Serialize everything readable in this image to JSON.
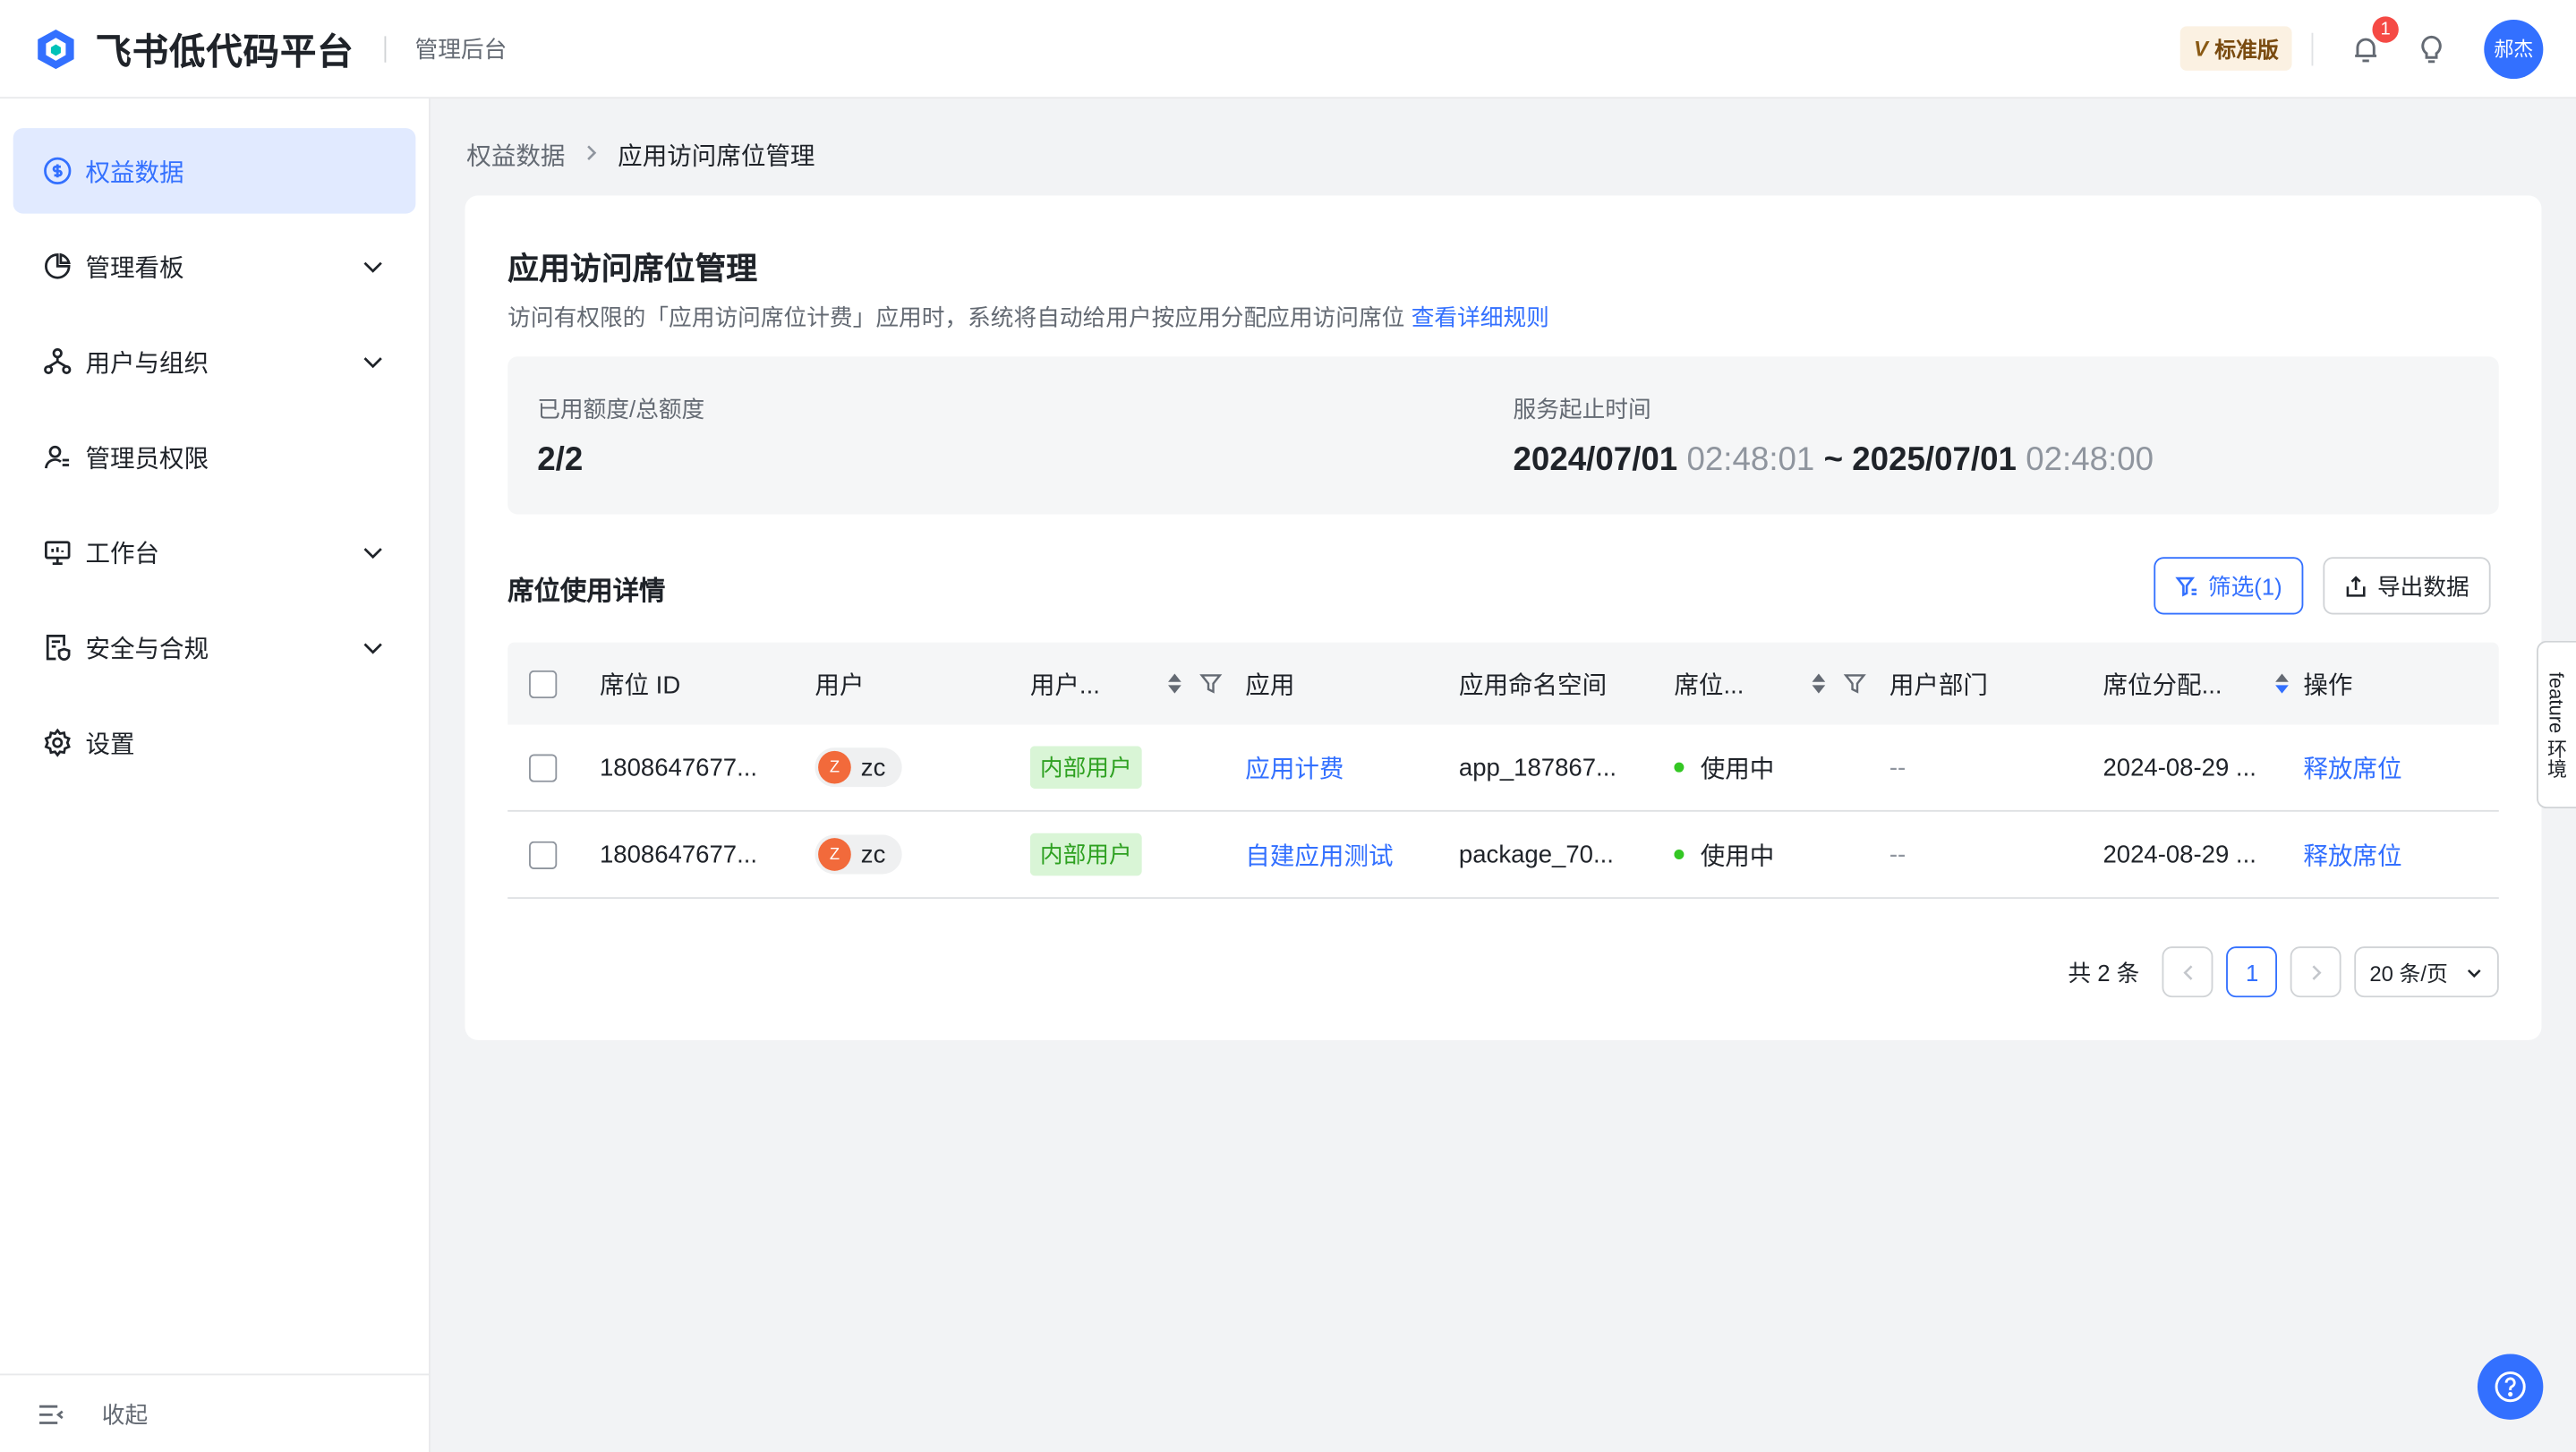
{
  "header": {
    "brand": "飞书低代码平台",
    "subtitle": "管理后台",
    "plan_badge": "标准版",
    "plan_badge_letter": "V",
    "notification_count": "1",
    "avatar_text": "郝杰"
  },
  "sidebar": {
    "items": [
      {
        "label": "权益数据",
        "icon": "dollar-circle-icon",
        "active": true,
        "expandable": false
      },
      {
        "label": "管理看板",
        "icon": "pie-chart-icon",
        "active": false,
        "expandable": true
      },
      {
        "label": "用户与组织",
        "icon": "org-tree-icon",
        "active": false,
        "expandable": true
      },
      {
        "label": "管理员权限",
        "icon": "admin-user-icon",
        "active": false,
        "expandable": false
      },
      {
        "label": "工作台",
        "icon": "monitor-icon",
        "active": false,
        "expandable": true
      },
      {
        "label": "安全与合规",
        "icon": "security-doc-icon",
        "active": false,
        "expandable": true
      },
      {
        "label": "设置",
        "icon": "gear-icon",
        "active": false,
        "expandable": false
      }
    ],
    "collapse_label": "收起"
  },
  "breadcrumb": {
    "parent": "权益数据",
    "current": "应用访问席位管理"
  },
  "card": {
    "title": "应用访问席位管理",
    "description": "访问有权限的「应用访问席位计费」应用时，系统将自动给用户按应用分配应用访问席位",
    "rules_link": "查看详细规则"
  },
  "summary": {
    "quota_label": "已用额度/总额度",
    "quota_value": "2/2",
    "period_label": "服务起止时间",
    "start_date": "2024/07/01",
    "start_time": "02:48:01",
    "range_sep": "~",
    "end_date": "2025/07/01",
    "end_time": "02:48:00"
  },
  "section": {
    "title": "席位使用详情",
    "filter_button": "筛选(1)",
    "export_button": "导出数据"
  },
  "table": {
    "columns": [
      "席位 ID",
      "用户",
      "用户...",
      "应用",
      "应用命名空间",
      "席位...",
      "用户部门",
      "席位分配...",
      "操作"
    ],
    "rows": [
      {
        "seat_id": "1808647677...",
        "user_initial": "Z",
        "user": "zc",
        "user_type": "内部用户",
        "app": "应用计费",
        "namespace": "app_187867...",
        "status": "使用中",
        "dept": "--",
        "assigned": "2024-08-29 ...",
        "action": "释放席位"
      },
      {
        "seat_id": "1808647677...",
        "user_initial": "Z",
        "user": "zc",
        "user_type": "内部用户",
        "app": "自建应用测试",
        "namespace": "package_70...",
        "status": "使用中",
        "dept": "--",
        "assigned": "2024-08-29 ...",
        "action": "释放席位"
      }
    ]
  },
  "pagination": {
    "total_label": "共 2 条",
    "current_page": "1",
    "page_size": "20 条/页"
  },
  "feature_tab": "feature 环境",
  "colors": {
    "accent": "#3370ff",
    "tag_bg": "#d9f5d6",
    "tag_text": "#2ea121",
    "status_green": "#34c724"
  }
}
